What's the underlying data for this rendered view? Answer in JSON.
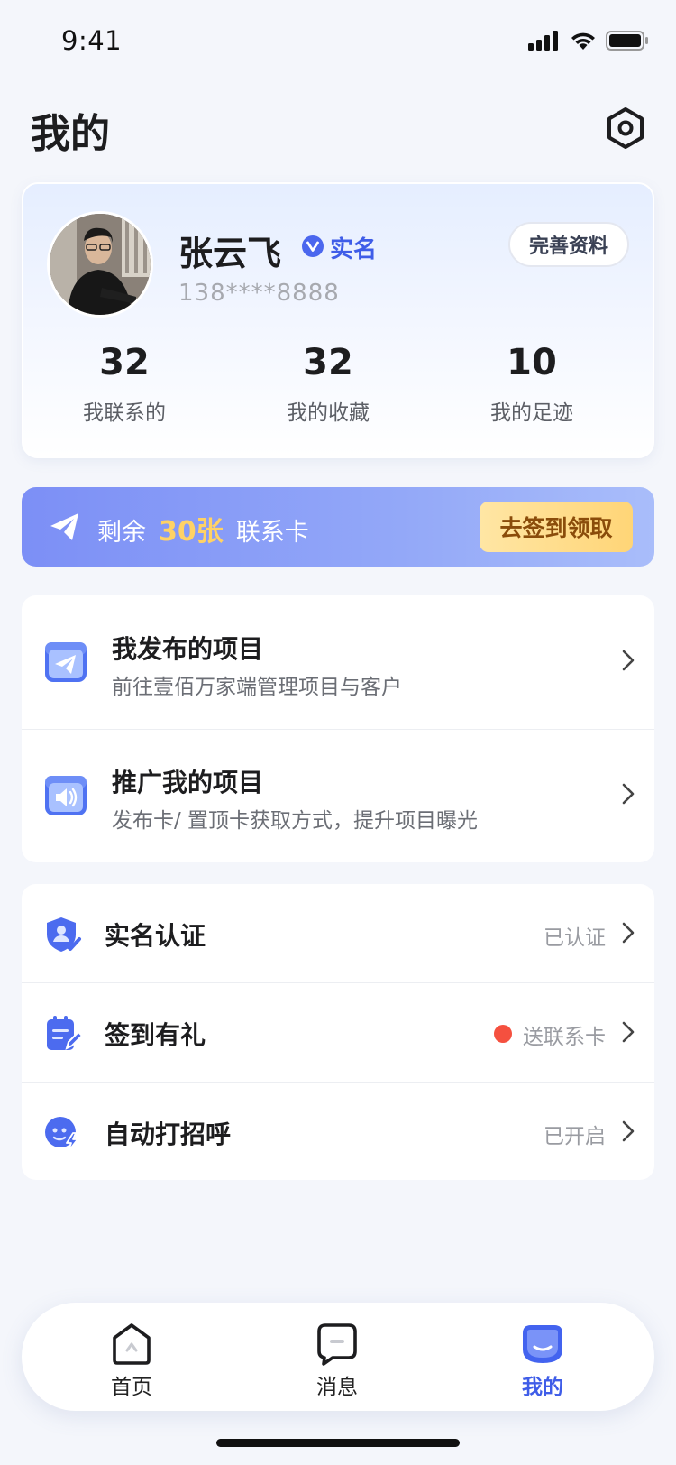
{
  "status_bar": {
    "time": "9:41",
    "icons": [
      "signal-icon",
      "wifi-icon",
      "battery-icon"
    ]
  },
  "header": {
    "title": "我的",
    "settings_icon": "settings-icon"
  },
  "profile": {
    "name": "张云飞",
    "verified_label": "实名",
    "phone": "138****8888",
    "edit_button": "完善资料",
    "stats": [
      {
        "value": "32",
        "label": "我联系的"
      },
      {
        "value": "32",
        "label": "我的收藏"
      },
      {
        "value": "10",
        "label": "我的足迹"
      }
    ]
  },
  "contact_card": {
    "prefix": "剩余",
    "count": "30张",
    "suffix": "联系卡",
    "button": "去签到领取"
  },
  "projects": [
    {
      "title": "我发布的项目",
      "desc": "前往壹佰万家端管理项目与客户",
      "icon": "paper-plane-icon"
    },
    {
      "title": "推广我的项目",
      "desc": "发布卡/ 置顶卡获取方式，提升项目曝光",
      "icon": "speaker-icon"
    }
  ],
  "settings": [
    {
      "label": "实名认证",
      "value": "已认证",
      "icon": "shield-user-icon",
      "dot": false
    },
    {
      "label": "签到有礼",
      "value": "送联系卡",
      "icon": "calendar-edit-icon",
      "dot": true
    },
    {
      "label": "自动打招呼",
      "value": "已开启",
      "icon": "face-bolt-icon",
      "dot": false
    }
  ],
  "tab_bar": {
    "tabs": [
      {
        "label": "首页",
        "icon": "home-icon",
        "active": false
      },
      {
        "label": "消息",
        "icon": "message-icon",
        "active": false
      },
      {
        "label": "我的",
        "icon": "profile-face-icon",
        "active": true
      }
    ]
  },
  "colors": {
    "accent": "#3f5de8",
    "gold": "#ffd265",
    "background": "#f4f6fb",
    "dot": "#f5503f"
  }
}
